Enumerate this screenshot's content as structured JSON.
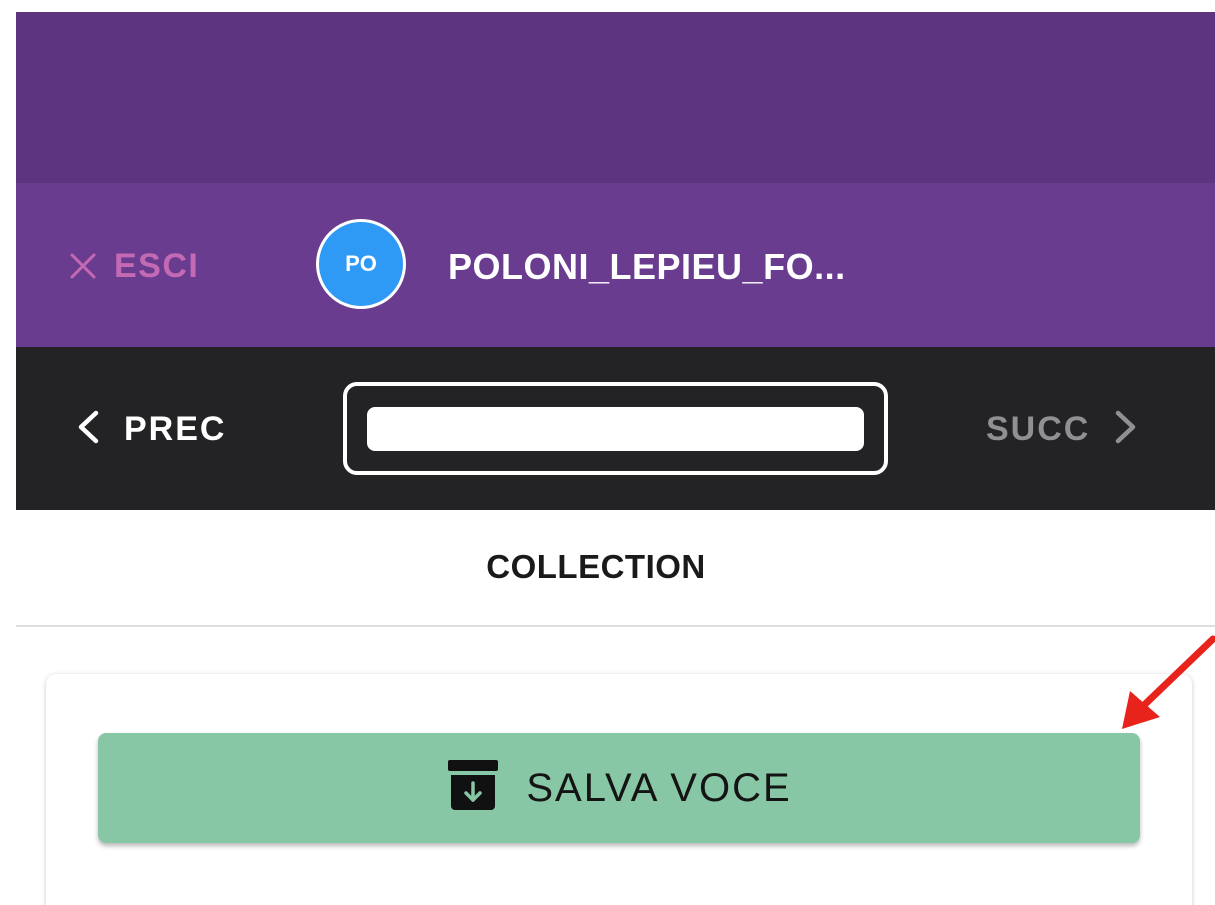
{
  "header": {
    "exit_label": "ESCI",
    "avatar_initials": "PO",
    "record_title": "POLONI_LEPIEU_FO..."
  },
  "navigation": {
    "prev_label": "PREC",
    "next_label": "SUCC",
    "record_field_value": ""
  },
  "section": {
    "title": "COLLECTION"
  },
  "actions": {
    "save_label": "SALVA VOCE",
    "save_icon": "archive-download-icon"
  },
  "colors": {
    "top_bar": "#5c347f",
    "header_bar": "#6a3c90",
    "exit_accent": "#c469b3",
    "avatar": "#2e9af5",
    "nav_bar": "#232326",
    "next_disabled": "#8f8f94",
    "save_button": "#88c7a6",
    "annotation_arrow": "#e8231b"
  }
}
